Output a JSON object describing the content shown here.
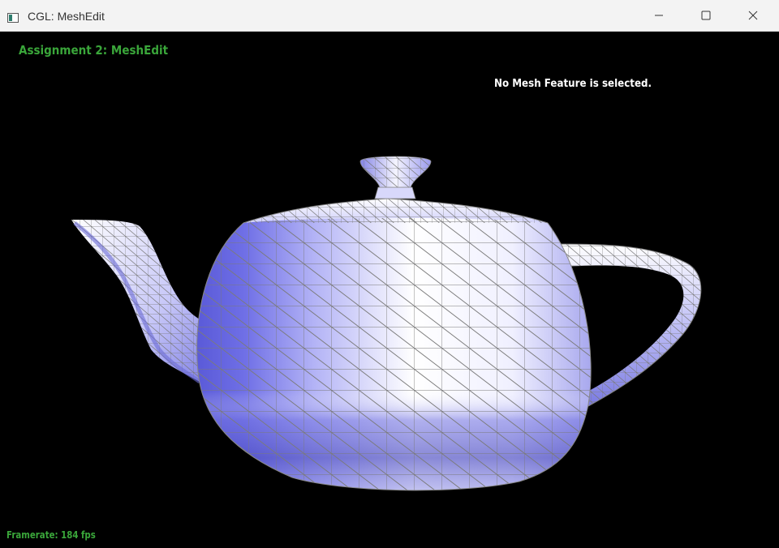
{
  "window": {
    "title": "CGL: MeshEdit",
    "controls": {
      "minimize": "minimize",
      "maximize": "maximize",
      "close": "close"
    }
  },
  "viewport": {
    "assignment_title": "Assignment 2: MeshEdit",
    "selection_status": "No Mesh Feature is selected.",
    "framerate_label": "Framerate:",
    "framerate_value": "184 fps",
    "model": "teapot"
  },
  "colors": {
    "background": "#000000",
    "overlay_green": "#3aa63a",
    "mesh_fill": "#9b9bf2",
    "mesh_lines": "#808080",
    "titlebar": "#f3f3f3"
  }
}
